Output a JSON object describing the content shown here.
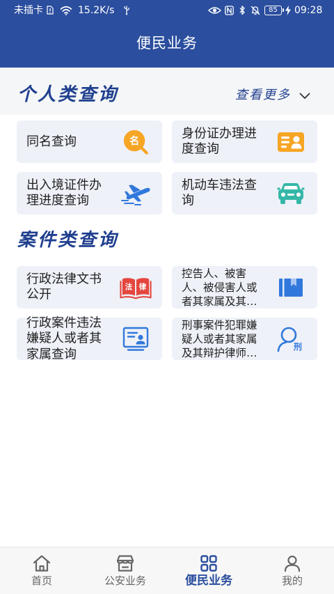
{
  "status_bar": {
    "carrier": "未插卡",
    "net_speed": "15.2K/s",
    "battery": "85",
    "time": "09:28",
    "icons": [
      "sim-icon",
      "wifi-icon",
      "usb-icon",
      "eye-icon",
      "nfc-icon",
      "bluetooth-icon",
      "mute-icon",
      "battery-icon",
      "charging-icon"
    ]
  },
  "header": {
    "title": "便民业务"
  },
  "personal": {
    "title": "个人类查询",
    "more": "查看更多",
    "more_icon": "chevron-down-icon",
    "items": [
      {
        "lines": [
          "同名查询"
        ],
        "icon": "name-search-icon",
        "icon_text": "名"
      },
      {
        "lines": [
          "身份证办理进",
          "度查询"
        ],
        "icon": "id-card-icon"
      },
      {
        "lines": [
          "出入境证件办",
          "理进度查询"
        ],
        "icon": "airplane-icon"
      },
      {
        "lines": [
          "机动车违法查",
          "询"
        ],
        "icon": "car-icon"
      }
    ]
  },
  "case": {
    "title": "案件类查询",
    "items": [
      {
        "lines": [
          "行政法律文书",
          "公开"
        ],
        "icon": "law-book-icon",
        "icon_text": [
          "法",
          "律"
        ]
      },
      {
        "lines": [
          "控告人、被害",
          "人、被侵害人或",
          "者其家属及其…"
        ],
        "icon": "archive-icon"
      },
      {
        "lines": [
          "行政案件违法",
          "嫌疑人或者其",
          "家属查询"
        ],
        "icon": "certificate-icon"
      },
      {
        "lines": [
          "刑事案件犯罪嫌",
          "疑人或者其家属",
          "及其辩护律师…"
        ],
        "icon": "criminal-person-icon",
        "icon_text": "刑"
      }
    ]
  },
  "tabbar": {
    "tabs": [
      {
        "label": "首页",
        "icon": "home-icon",
        "active": false
      },
      {
        "label": "公安业务",
        "icon": "shop-icon",
        "active": false
      },
      {
        "label": "便民业务",
        "icon": "grid-icon",
        "active": true
      },
      {
        "label": "我的",
        "icon": "profile-icon",
        "active": false
      }
    ]
  },
  "colors": {
    "primary": "#2b4e9e",
    "heading": "#1f3f8e",
    "card_bg": "#eef1f8",
    "orange": "#f6a524",
    "red": "#e4463e",
    "teal": "#35b7a8",
    "blue_icon": "#3178dc",
    "tab_inactive": "#666666",
    "band_bg": "#f5f6f8",
    "tabbar_bg": "#f7f7f7"
  }
}
